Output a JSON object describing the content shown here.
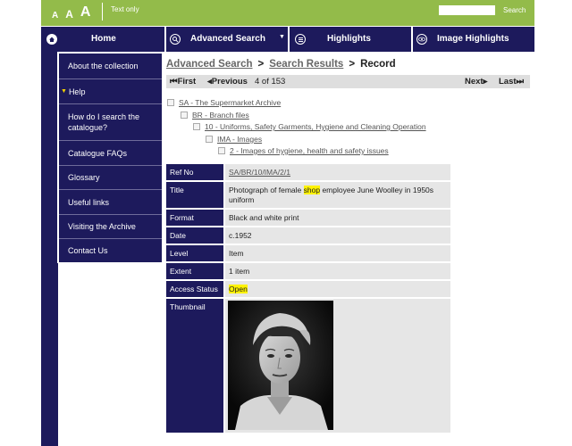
{
  "topbar": {
    "font_sizes": [
      "A",
      "A",
      "A"
    ],
    "text_only": "Text only",
    "search_placeholder": "",
    "search_button": "Search"
  },
  "nav": {
    "home": "Home",
    "advanced_search": "Advanced Search",
    "highlights": "Highlights",
    "image_highlights": "Image Highlights"
  },
  "sidebar": {
    "items": [
      {
        "label": "About the collection"
      },
      {
        "label": "Help"
      },
      {
        "label": "How do I search the catalogue?"
      },
      {
        "label": "Catalogue FAQs"
      },
      {
        "label": "Glossary"
      },
      {
        "label": "Useful links"
      },
      {
        "label": "Visiting the Archive"
      },
      {
        "label": "Contact Us"
      }
    ]
  },
  "breadcrumb": {
    "advanced_search": "Advanced Search",
    "sep": ">",
    "search_results": "Search Results",
    "record": "Record"
  },
  "pager": {
    "first": "First",
    "previous": "Previous",
    "position": "4 of 153",
    "next": "Next",
    "last": "Last"
  },
  "hierarchy": [
    "SA - The Supermarket Archive",
    "BR - Branch files",
    "10 - Uniforms, Safety Garments, Hygiene and Cleaning Operation",
    "IMA - Images",
    "2 - Images of hygiene, health and safety issues"
  ],
  "record": {
    "ref_no_label": "Ref No",
    "ref_no": "SA/BR/10/IMA/2/1",
    "title_label": "Title",
    "title_pre": "Photograph of female ",
    "title_hl": "shop",
    "title_post": " employee June Woolley in 1950s uniform",
    "format_label": "Format",
    "format": "Black and white print",
    "date_label": "Date",
    "date": "c.1952",
    "level_label": "Level",
    "level": "Item",
    "extent_label": "Extent",
    "extent": "1 item",
    "access_label": "Access Status",
    "access": "Open",
    "thumbnail_label": "Thumbnail"
  },
  "colors": {
    "green": "#93bb4a",
    "navy": "#1d1a5c",
    "highlight": "#fff200"
  }
}
